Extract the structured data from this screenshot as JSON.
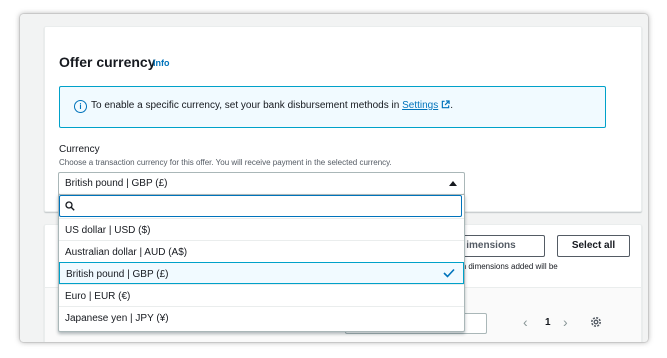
{
  "panel": {
    "title": "Offer currency",
    "info_label": "Info",
    "alert_text": "To enable a specific currency, set your bank disbursement methods in",
    "alert_link": "Settings",
    "alert_end": "."
  },
  "currency_field": {
    "label": "Currency",
    "description": "Choose a transaction currency for this offer. You will receive payment in the selected currency.",
    "selected_value": "British pound | GBP (£)"
  },
  "dropdown": {
    "search_placeholder": "",
    "options": [
      {
        "label": "US dollar | USD ($)",
        "selected": false
      },
      {
        "label": "Australian dollar | AUD (A$)",
        "selected": false
      },
      {
        "label": "British pound | GBP (£)",
        "selected": true
      },
      {
        "label": "Euro | EUR (€)",
        "selected": false
      },
      {
        "label": "Japanese yen | JPY (¥)",
        "selected": false
      }
    ]
  },
  "background_panel": {
    "dimensions_button": "imensions",
    "select_all_button": "Select all",
    "note_text": "om dimensions added will be",
    "current_page": "1"
  },
  "colors": {
    "accent": "#0073bb",
    "alert_bg": "#f1faff",
    "alert_border": "#00a1c9"
  },
  "icons": [
    "info-icon",
    "external-link-icon",
    "caret-up-icon",
    "search-icon",
    "check-icon",
    "chevron-left-icon",
    "chevron-right-icon",
    "gear-icon"
  ]
}
